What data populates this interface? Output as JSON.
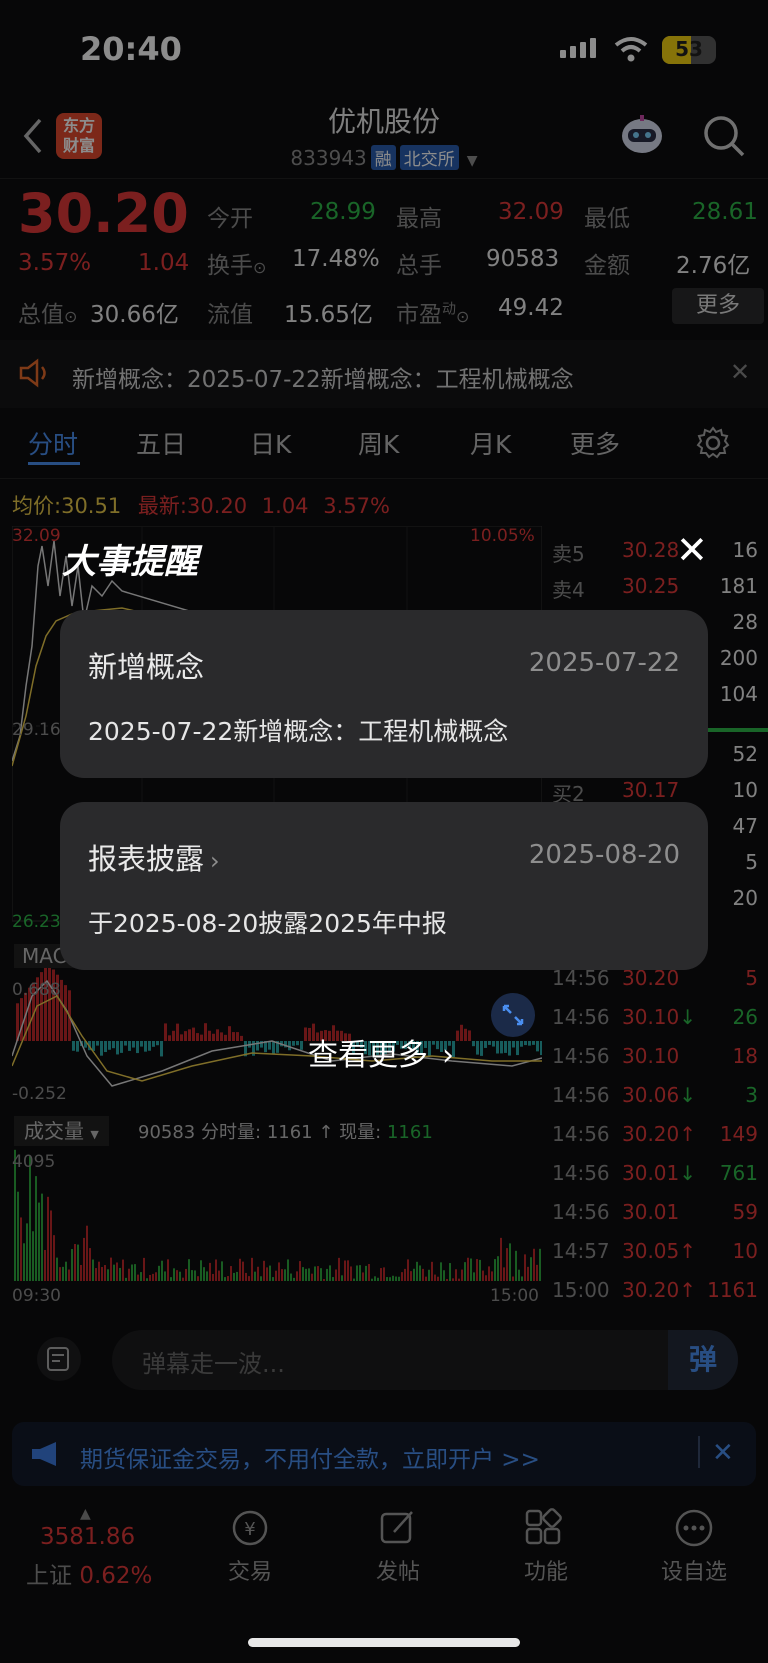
{
  "status_bar": {
    "time": "20:40",
    "battery": "53",
    "battery_level": 0.53
  },
  "header": {
    "title": "优机股份",
    "code": "833943",
    "tag_margin": "融",
    "tag_exchange": "北交所",
    "logo_line1": "东方",
    "logo_line2": "财富"
  },
  "quote": {
    "price": "30.20",
    "change_pct": "3.57%",
    "change": "1.04",
    "open_label": "今开",
    "open": "28.99",
    "high_label": "最高",
    "high": "32.09",
    "low_label": "最低",
    "low": "28.61",
    "turnover_label": "换手",
    "turnover": "17.48%",
    "volume_label": "总手",
    "volume": "90583",
    "amount_label": "金额",
    "amount": "2.76亿",
    "mktcap_label": "总值",
    "mktcap": "30.66亿",
    "float_label": "流值",
    "float": "15.65亿",
    "pe_label": "市盈",
    "pe_sup": "动",
    "pe": "49.42",
    "more_label": "更多"
  },
  "notice": {
    "text": "新增概念：2025-07-22新增概念：工程机械概念"
  },
  "tabs": [
    "分时",
    "五日",
    "日K",
    "周K",
    "月K",
    "更多"
  ],
  "chart": {
    "avg_label": "均价:",
    "avg": "30.51",
    "latest_label": "最新:",
    "latest": "30.20",
    "latest_change": "1.04",
    "latest_pct": "3.57%",
    "y_top": "32.09",
    "y_pct_top": "10.05%",
    "y_mid": "29.16",
    "y_bottom": "26.23",
    "macd_label": "MACD",
    "macd_top": "0.688",
    "macd_bottom": "-0.252",
    "vol_label": "成交量",
    "vol_total": "90583",
    "vol_minute_label": "分时量:",
    "vol_minute": "1161",
    "vol_now_label": "现量:",
    "vol_now": "1161",
    "vol_top": "4095",
    "time_start": "09:30",
    "time_end": "15:00"
  },
  "order_book": [
    {
      "label": "卖5",
      "price": "30.28",
      "vol": "16"
    },
    {
      "label": "卖4",
      "price": "30.25",
      "vol": "181"
    },
    {
      "label": "",
      "price": "",
      "vol": "28"
    },
    {
      "label": "",
      "price": "",
      "vol": "200"
    },
    {
      "label": "",
      "price": "",
      "vol": "104"
    },
    {
      "label": "",
      "price": "",
      "vol": "52"
    },
    {
      "label": "买2",
      "price": "30.17",
      "vol": "10"
    },
    {
      "label": "",
      "price": "",
      "vol": "47"
    },
    {
      "label": "",
      "price": "",
      "vol": "5"
    },
    {
      "label": "",
      "price": "",
      "vol": "20"
    }
  ],
  "ticks": [
    {
      "time": "14:56",
      "price": "30.20",
      "arrow": "",
      "vol": "5",
      "pc": "red",
      "vc": "red"
    },
    {
      "time": "14:56",
      "price": "30.10",
      "arrow": "↓",
      "vol": "26",
      "pc": "red",
      "vc": "green"
    },
    {
      "time": "14:56",
      "price": "30.10",
      "arrow": "",
      "vol": "18",
      "pc": "red",
      "vc": "red"
    },
    {
      "time": "14:56",
      "price": "30.06",
      "arrow": "↓",
      "vol": "3",
      "pc": "red",
      "vc": "green"
    },
    {
      "time": "14:56",
      "price": "30.20",
      "arrow": "↑",
      "vol": "149",
      "pc": "red",
      "vc": "red"
    },
    {
      "time": "14:56",
      "price": "30.01",
      "arrow": "↓",
      "vol": "761",
      "pc": "red",
      "vc": "green"
    },
    {
      "time": "14:56",
      "price": "30.01",
      "arrow": "",
      "vol": "59",
      "pc": "red",
      "vc": "red"
    },
    {
      "time": "14:57",
      "price": "30.05",
      "arrow": "↑",
      "vol": "10",
      "pc": "red",
      "vc": "red"
    },
    {
      "time": "15:00",
      "price": "30.20",
      "arrow": "↑",
      "vol": "1161",
      "pc": "red",
      "vc": "red"
    }
  ],
  "overlay": {
    "heading": "大事提醒",
    "cards": [
      {
        "title": "新增概念",
        "date": "2025-07-22",
        "body": "2025-07-22新增概念：工程机械概念"
      },
      {
        "title": "报表披露",
        "date": "2025-08-20",
        "body": "于2025-08-20披露2025年中报"
      }
    ],
    "more_label": "查看更多"
  },
  "danmu": {
    "placeholder": "弹幕走一波...",
    "send_label": "弹"
  },
  "ad": {
    "text": "期货保证金交易，不用付全款，立即开户 >>"
  },
  "bottom_nav": {
    "index_value": "3581.86",
    "index_name": "上证",
    "index_pct": "0.62%",
    "items": [
      "交易",
      "发帖",
      "功能",
      "设自选"
    ]
  },
  "colors": {
    "up": "#e03a3a",
    "down": "#2fb84a",
    "accent": "#4a8eef",
    "avg_line": "#e8c84a"
  }
}
